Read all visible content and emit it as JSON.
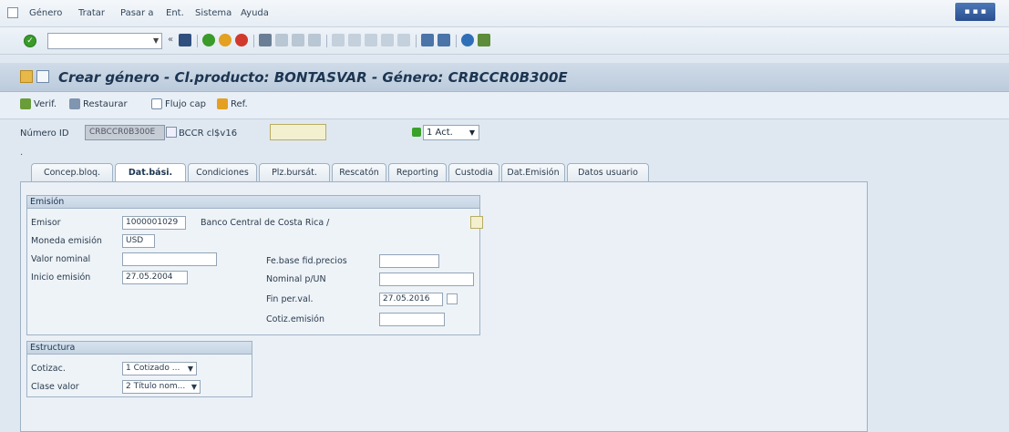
{
  "menubar": {
    "items": [
      "Género",
      "Tratar",
      "Pasar a",
      "Ent.",
      "Sistema",
      "Ayuda"
    ]
  },
  "toolbar": {
    "command_value": ""
  },
  "title": {
    "text": "Crear género - Cl.producto: BONTASVAR - Género: CRBCCR0B300E"
  },
  "appbar": {
    "verify": "Verif.",
    "restore": "Restaurar",
    "flows": "Flujo cap",
    "ref": "Ref."
  },
  "header": {
    "id_label": "Número ID",
    "id_value": "CRBCCR0B300E",
    "id_desc": "BCCR cl$v16",
    "status_value": "1 Act.",
    "dot": "."
  },
  "tabs": [
    {
      "label": "Concep.bloq."
    },
    {
      "label": "Dat.bási."
    },
    {
      "label": "Condiciones"
    },
    {
      "label": "Plz.bursát."
    },
    {
      "label": "Rescatón"
    },
    {
      "label": "Reporting"
    },
    {
      "label": "Custodia"
    },
    {
      "label": "Dat.Emisión"
    },
    {
      "label": "Datos usuario"
    }
  ],
  "emision": {
    "title": "Emisión",
    "emisor_label": "Emisor",
    "emisor_value": "1000001029",
    "emisor_desc": "Banco Central de Costa Rica /",
    "moneda_label": "Moneda emisión",
    "moneda_value": "USD",
    "valor_label": "Valor nominal",
    "valor_value": "",
    "inicio_label": "Inicio emisión",
    "inicio_value": "27.05.2004",
    "fe_base_label": "Fe.base fid.precios",
    "fe_base_value": "",
    "nominal_label": "Nominal p/UN",
    "nominal_value": "",
    "fin_label": "Fin per.val.",
    "fin_value": "27.05.2016",
    "cotiz_label": "Cotiz.emisión",
    "cotiz_value": ""
  },
  "estructura": {
    "title": "Estructura",
    "cotiz_label": "Cotizac.",
    "cotiz_value": "1 Cotizado ...",
    "clase_label": "Clase valor",
    "clase_value": "2 Título nom..."
  }
}
